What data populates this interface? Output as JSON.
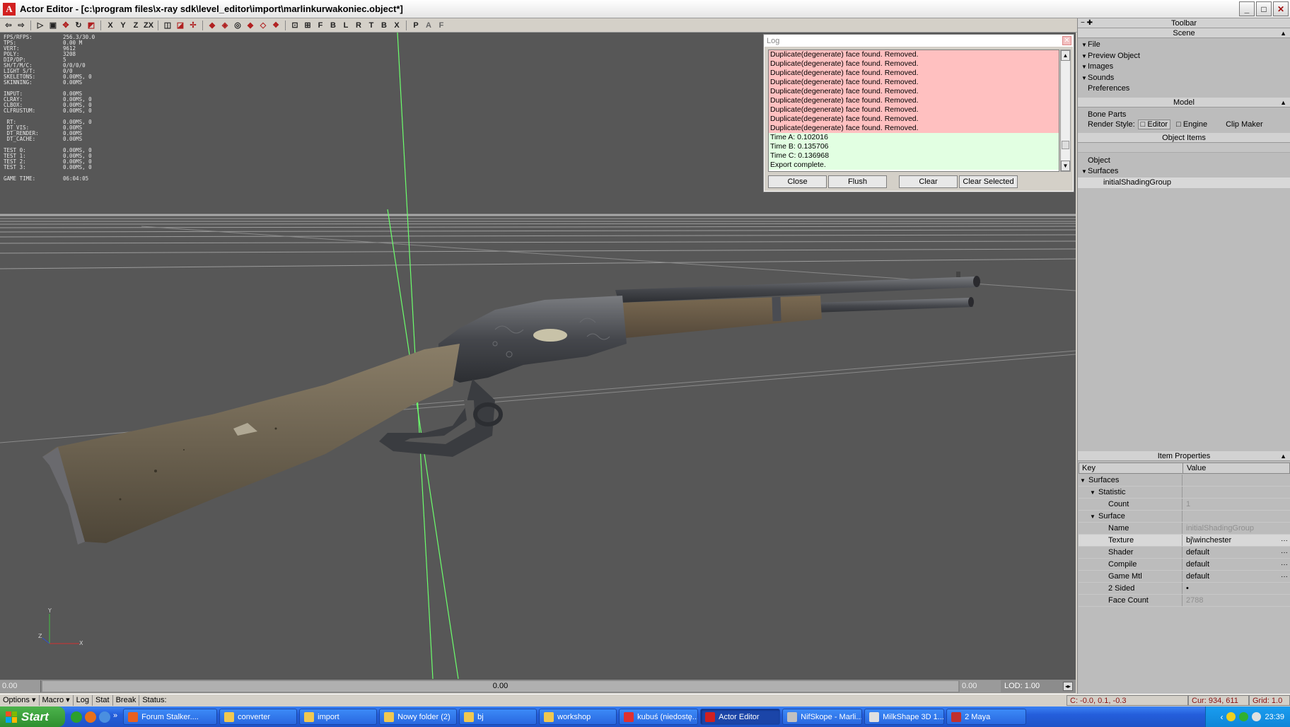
{
  "window": {
    "app_name": "Actor Editor",
    "title": "Actor Editor - [c:\\program files\\x-ray sdk\\level_editor\\import\\marlinkurwakoniec.object*]",
    "controls": {
      "minimize": "_",
      "maximize": "□",
      "close": "✕"
    }
  },
  "toolbar": {
    "axis_buttons": [
      "X",
      "Y",
      "Z",
      "ZX"
    ],
    "view_buttons": [
      "F",
      "B",
      "L",
      "R",
      "T",
      "B",
      "X"
    ],
    "extra_buttons": [
      "P",
      "A",
      "F"
    ]
  },
  "stats": [
    {
      "k": "FPS/RFPS:",
      "v": "256.3/30.0"
    },
    {
      "k": "TPS:",
      "v": "0.00 M"
    },
    {
      "k": "VERT:",
      "v": "9612"
    },
    {
      "k": "POLY:",
      "v": "3208"
    },
    {
      "k": "DIP/DP:",
      "v": "5"
    },
    {
      "k": "SH/T/M/C:",
      "v": "0/0/0/0"
    },
    {
      "k": "LIGHT S/T:",
      "v": "0/0"
    },
    {
      "k": "SKELETONS:",
      "v": "0.00MS, 0"
    },
    {
      "k": "SKINNING:",
      "v": "0.00MS"
    },
    {
      "k": "",
      "v": ""
    },
    {
      "k": "INPUT:",
      "v": "0.00MS"
    },
    {
      "k": "CLRAY:",
      "v": "0.00MS, 0"
    },
    {
      "k": "CLBOX:",
      "v": "0.00MS, 0"
    },
    {
      "k": "CLFRUSTUM:",
      "v": "0.00MS, 0"
    },
    {
      "k": "",
      "v": ""
    },
    {
      "k": " RT:",
      "v": "0.00MS, 0"
    },
    {
      "k": " DT_VIS:",
      "v": "0.00MS"
    },
    {
      "k": " DT_RENDER:",
      "v": "0.00MS"
    },
    {
      "k": " DT_CACHE:",
      "v": "0.00MS"
    },
    {
      "k": "",
      "v": ""
    },
    {
      "k": "TEST 0:",
      "v": "0.00MS, 0"
    },
    {
      "k": "TEST 1:",
      "v": "0.00MS, 0"
    },
    {
      "k": "TEST 2:",
      "v": "0.00MS, 0"
    },
    {
      "k": "TEST 3:",
      "v": "0.00MS, 0"
    },
    {
      "k": "",
      "v": ""
    },
    {
      "k": "GAME TIME:",
      "v": "06:04:05"
    }
  ],
  "log": {
    "title": "Log",
    "lines": [
      {
        "text": "Duplicate(degenerate) face found. Removed.",
        "kind": "err"
      },
      {
        "text": "Duplicate(degenerate) face found. Removed.",
        "kind": "err"
      },
      {
        "text": "Duplicate(degenerate) face found. Removed.",
        "kind": "err"
      },
      {
        "text": "Duplicate(degenerate) face found. Removed.",
        "kind": "err"
      },
      {
        "text": "Duplicate(degenerate) face found. Removed.",
        "kind": "err"
      },
      {
        "text": "Duplicate(degenerate) face found. Removed.",
        "kind": "err"
      },
      {
        "text": "Duplicate(degenerate) face found. Removed.",
        "kind": "err"
      },
      {
        "text": "Duplicate(degenerate) face found. Removed.",
        "kind": "err"
      },
      {
        "text": "Duplicate(degenerate) face found. Removed.",
        "kind": "err"
      },
      {
        "text": "Time A:  0.102016",
        "kind": "ok"
      },
      {
        "text": "Time B:  0.135706",
        "kind": "ok"
      },
      {
        "text": "Time C:  0.136968",
        "kind": "ok"
      },
      {
        "text": "Export complete.",
        "kind": "ok"
      }
    ],
    "buttons": [
      "Close",
      "Flush",
      "Clear",
      "Clear Selected"
    ]
  },
  "panel": {
    "toolbar_header": "Toolbar",
    "scene_header": "Scene",
    "scene_items": [
      {
        "label": "File",
        "toggle": "▼"
      },
      {
        "label": "Preview Object",
        "toggle": "▼"
      },
      {
        "label": "Images",
        "toggle": "▼"
      },
      {
        "label": "Sounds",
        "toggle": "▼"
      },
      {
        "label": "Preferences",
        "toggle": ""
      }
    ],
    "model_header": "Model",
    "bone_parts": "Bone Parts",
    "render_style_label": "Render Style:",
    "render_editor": "Editor",
    "render_engine": "Engine",
    "clip_maker": "Clip Maker",
    "object_items_header": "Object Items",
    "object_tree": [
      {
        "label": "Object",
        "toggle": "",
        "indent": 0
      },
      {
        "label": "Surfaces",
        "toggle": "▼",
        "indent": 0
      },
      {
        "label": "initialShadingGroup",
        "toggle": "",
        "indent": 1
      }
    ],
    "item_props_header": "Item Properties",
    "col_key": "Key",
    "col_value": "Value",
    "props": [
      {
        "key": "Surfaces",
        "val": "",
        "indent": 0,
        "toggle": "▼",
        "dim": false,
        "dots": false
      },
      {
        "key": "Statistic",
        "val": "",
        "indent": 1,
        "toggle": "▼",
        "dim": false,
        "dots": false
      },
      {
        "key": "Count",
        "val": "1",
        "indent": 2,
        "toggle": "",
        "dim": true,
        "dots": false
      },
      {
        "key": "Surface",
        "val": "",
        "indent": 1,
        "toggle": "▼",
        "dim": false,
        "dots": false
      },
      {
        "key": "Name",
        "val": "initialShadingGroup",
        "indent": 2,
        "toggle": "",
        "dim": true,
        "dots": false
      },
      {
        "key": "Texture",
        "val": "bj\\winchester",
        "indent": 2,
        "toggle": "",
        "dim": false,
        "dots": true,
        "sel": true
      },
      {
        "key": "Shader",
        "val": "default",
        "indent": 2,
        "toggle": "",
        "dim": false,
        "dots": true
      },
      {
        "key": "Compile",
        "val": "default",
        "indent": 2,
        "toggle": "",
        "dim": false,
        "dots": true
      },
      {
        "key": "Game Mtl",
        "val": "default",
        "indent": 2,
        "toggle": "",
        "dim": false,
        "dots": true
      },
      {
        "key": "2 Sided",
        "val": "•",
        "indent": 2,
        "toggle": "",
        "dim": false,
        "dots": false
      },
      {
        "key": "Face Count",
        "val": "2788",
        "indent": 2,
        "toggle": "",
        "dim": true,
        "dots": false
      }
    ]
  },
  "timeline": {
    "left": "0.00",
    "middle": "0.00",
    "right": "0.00",
    "lod": "LOD: 1.00"
  },
  "statusbar": {
    "items": [
      "Options",
      "Macro",
      "Log",
      "Stat",
      "Break",
      "Status:"
    ],
    "coords": "C: -0.0, 0.1, -0.3",
    "cursor": "Cur: 934, 611",
    "grid": "Grid: 1.0"
  },
  "taskbar": {
    "start": "Start",
    "tasks": [
      {
        "label": "Forum Stalker....",
        "color": "#e86020",
        "active": false
      },
      {
        "label": "converter",
        "color": "#f0c850",
        "active": false
      },
      {
        "label": "import",
        "color": "#f0c850",
        "active": false
      },
      {
        "label": "Nowy folder (2)",
        "color": "#f0c850",
        "active": false
      },
      {
        "label": "bj",
        "color": "#f0c850",
        "active": false
      },
      {
        "label": "workshop",
        "color": "#f0c850",
        "active": false
      },
      {
        "label": "kubuś (niedostę...",
        "color": "#e03030",
        "active": false
      },
      {
        "label": "Actor Editor",
        "color": "#d02020",
        "active": true
      },
      {
        "label": "NifSkope - Marli...",
        "color": "#c0c0c0",
        "active": false
      },
      {
        "label": "MilkShape 3D 1....",
        "color": "#e0e0e0",
        "active": false
      },
      {
        "label": "2 Maya",
        "color": "#c03030",
        "active": false
      }
    ],
    "clock": "23:39"
  },
  "colors": {
    "viewport_bg": "#575757",
    "grid_line": "#9a9a9a",
    "axis_green": "#6cff6c",
    "wood": "#6e6450",
    "metal": "#3c3e42"
  }
}
